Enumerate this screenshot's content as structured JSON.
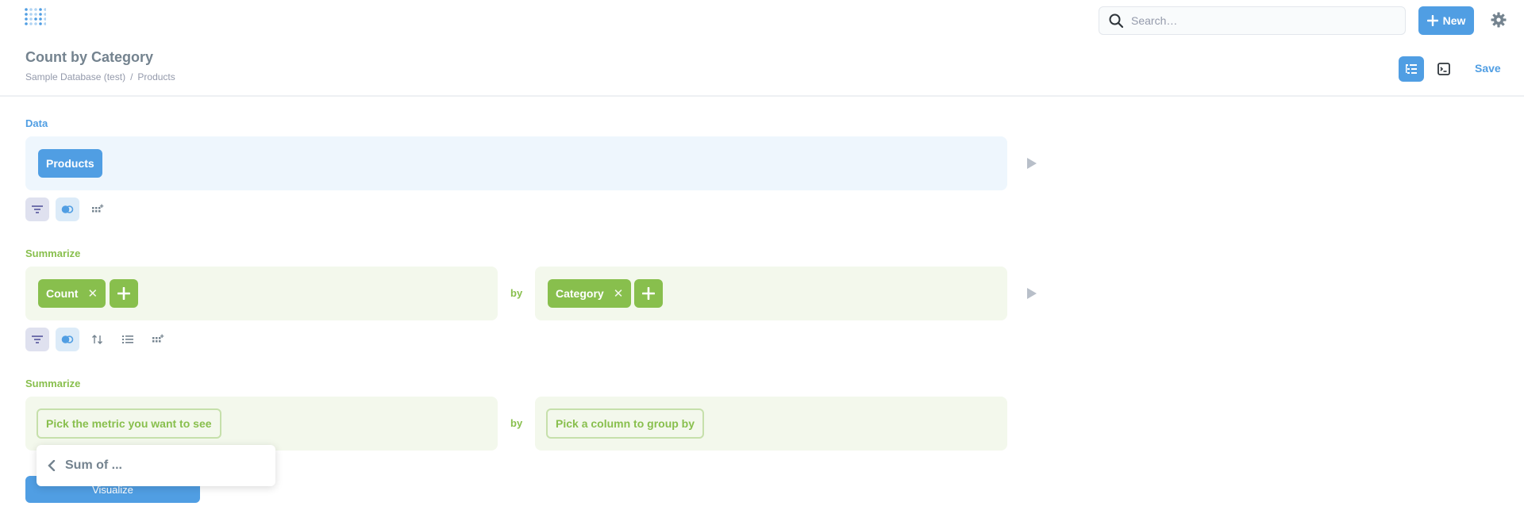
{
  "nav": {
    "search_placeholder": "Search…",
    "new_label": "New"
  },
  "header": {
    "title": "Count by Category",
    "breadcrumb": {
      "database": "Sample Database (test)",
      "separator": "/",
      "table": "Products"
    },
    "save_label": "Save"
  },
  "data_step": {
    "label": "Data",
    "table": "Products"
  },
  "summarize_step_1": {
    "label": "Summarize",
    "metric": "Count",
    "by_label": "by",
    "breakout": "Category"
  },
  "summarize_step_2": {
    "label": "Summarize",
    "metric_placeholder": "Pick the metric you want to see",
    "by_label": "by",
    "breakout_placeholder": "Pick a column to group by"
  },
  "popover": {
    "title": "Sum of ..."
  },
  "visualize_label": "Visualize",
  "colors": {
    "brand": "#509ee3",
    "summarize": "#88bf4d",
    "text": "#4c5773"
  }
}
